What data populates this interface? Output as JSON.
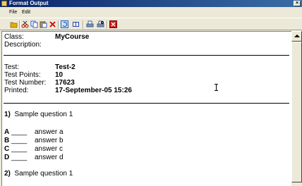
{
  "window": {
    "title": "Format Output",
    "close_glyph": "×"
  },
  "menu": [
    {
      "label": "File"
    },
    {
      "label": "Edit"
    }
  ],
  "toolbar": {
    "buttons": [
      {
        "name": "open-icon",
        "color": "#e0b000"
      },
      {
        "name": "cut-icon",
        "color": "#c00000"
      },
      {
        "name": "copy-icon",
        "color": "#3060c0"
      },
      {
        "name": "paste-icon",
        "color": "#3060c0"
      },
      {
        "name": "delete-icon",
        "color": "#d00000"
      },
      {
        "name": "refresh-icon",
        "color": "#2060c0"
      },
      {
        "name": "book-icon",
        "color": "#2040a0"
      },
      {
        "name": "print-icon",
        "color": "#406090"
      },
      {
        "name": "print-preview-icon",
        "color": "#406090"
      },
      {
        "name": "exit-icon",
        "color": "#d02020"
      }
    ]
  },
  "header": {
    "class_label": "Class:",
    "class_value": "MyCourse",
    "description_label": "Description:"
  },
  "test_info": {
    "test_label": "Test:",
    "test_value": "Test-2",
    "points_label": "Test Points:",
    "points_value": "10",
    "number_label": "Test Number:",
    "number_value": "17623",
    "printed_label": "Printed:",
    "printed_value": "17-September-05 15:26"
  },
  "questions": [
    {
      "number": "1)",
      "text": "Sample question 1",
      "answers": [
        {
          "letter": "A",
          "blank": "____",
          "text": "answer a"
        },
        {
          "letter": "B",
          "blank": "____",
          "text": "answer b"
        },
        {
          "letter": "C",
          "blank": "____",
          "text": "answer c"
        },
        {
          "letter": "D",
          "blank": "____",
          "text": "answer d"
        }
      ]
    },
    {
      "number": "2)",
      "text": "Sample question 1"
    }
  ]
}
